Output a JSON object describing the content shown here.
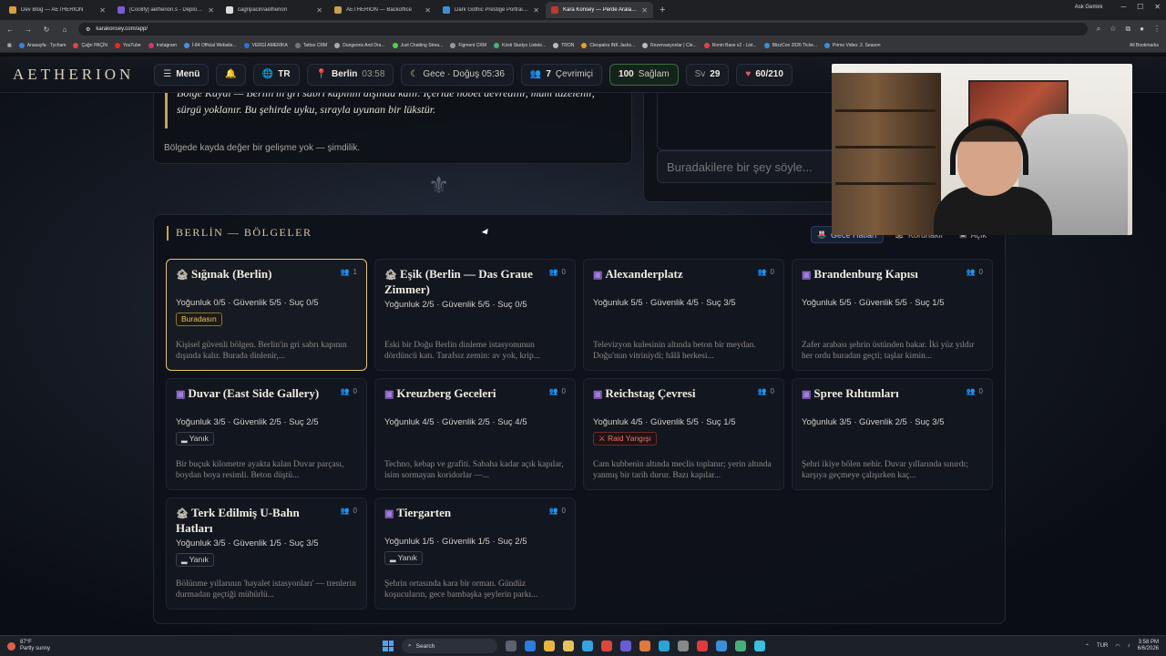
{
  "browser": {
    "tabs": [
      {
        "title": "Dev Blog — AETHERION",
        "color": "#e0a030",
        "active": false
      },
      {
        "title": "[Coolify] aetherion.s - Deploym",
        "color": "#7b5cd6",
        "active": false
      },
      {
        "title": "cagripacin/aetherion",
        "color": "#dddddd",
        "active": false
      },
      {
        "title": "AETHERION — Backoffice",
        "color": "#c9a24a",
        "active": false
      },
      {
        "title": "Dark Gothic Prestige Portraits n",
        "color": "#3a8fd6",
        "active": false
      },
      {
        "title": "Kara Konsey — Perde Aralanıyor",
        "color": "#c0392b",
        "active": true
      }
    ],
    "profile": "Ask Gemini",
    "url": "karakonsey.com/app/",
    "bookmarks": [
      {
        "label": "Anasayfa - Tycham",
        "color": "#3f7fe0"
      },
      {
        "label": "Çağrı PAÇİN",
        "color": "#e04545"
      },
      {
        "label": "YouTube",
        "color": "#ff2020"
      },
      {
        "label": "Instagram",
        "color": "#d6327a"
      },
      {
        "label": "İ-84 Official Website...",
        "color": "#4a90e2"
      },
      {
        "label": "VERGİ AMERİKA",
        "color": "#2d6fd1"
      },
      {
        "label": "Tattoo CRM",
        "color": "#777777"
      },
      {
        "label": "Dungeons And Dra...",
        "color": "#aaaaaa"
      },
      {
        "label": "Just Chatting Strea...",
        "color": "#4fd64f"
      },
      {
        "label": "Figment CRM",
        "color": "#999999"
      },
      {
        "label": "Kristi Studyo Listele...",
        "color": "#46b07a"
      },
      {
        "label": "TRON",
        "color": "#bbbbbb"
      },
      {
        "label": "Cleopatra INK Jacks...",
        "color": "#e0a030"
      },
      {
        "label": "Rezervasyonlar | Cle...",
        "color": "#bbbbbb"
      },
      {
        "label": "Ronin Base v2 - List...",
        "color": "#e04545"
      },
      {
        "label": "BlizzCon 2026 Ticke...",
        "color": "#3a8fd6"
      },
      {
        "label": "Prime Video: 2. Season",
        "color": "#3a8fd6"
      }
    ],
    "all_bookmarks": "All Bookmarks"
  },
  "header": {
    "logo": "AETHERION",
    "menu": "Menü",
    "lang": "TR",
    "city": "Berlin",
    "city_time": "03:58",
    "time_phase": "Gece · Doğuş 05:36",
    "online_count": "7",
    "online_label": "Çevrimiçi",
    "health_value": "100",
    "health_label": "Sağlam",
    "level_label": "Sv",
    "level_value": "29",
    "hp": "60/210"
  },
  "log": {
    "quote": "Bölge Kaydı — Berlin'in gri sabrı kapının dışında kalır. İçeride nöbet devredilir, mum tazelenir, sürgü yoklanır. Bu şehirde uyku, sırayla uyunan bir lükstür.",
    "no_change": "Bölgede kayda değer bir gelişme yok — şimdilik."
  },
  "chat": {
    "placeholder": "Buradakilere bir şey söyle..."
  },
  "regions": {
    "title": "BERLİN — BÖLGELER",
    "legend": [
      {
        "label": "Gece Hatları",
        "active": true
      },
      {
        "label": "Korunaklı",
        "active": false
      },
      {
        "label": "Açık",
        "active": false
      }
    ],
    "cards": [
      {
        "name": "Sığınak (Berlin)",
        "kind": "safe",
        "icon": "🏚",
        "occupants": "1",
        "stats": "Yoğunluk 0/5 · Güvenlik 5/5 · Suç 0/5",
        "tag": "Buradasın",
        "tag_type": "here",
        "desc": "Kişisel güvenli bölgen. Berlin'in gri sabrı kapının dışında kalır. Burada dinlenir,...",
        "current": true
      },
      {
        "name": "Eşik (Berlin — Das Graue Zimmer)",
        "kind": "safe",
        "icon": "🏚",
        "occupants": "0",
        "stats": "Yoğunluk 2/5 · Güvenlik 5/5 · Suç 0/5",
        "tag": "",
        "tag_type": "",
        "desc": "Eski bir Doğu Berlin dinleme istasyonunun dördüncü katı. Tarafsız zemin: av yok, krip...",
        "current": false
      },
      {
        "name": "Alexanderplatz",
        "kind": "wild",
        "icon": "▣",
        "occupants": "0",
        "stats": "Yoğunluk 5/5 · Güvenlik 4/5 · Suç 3/5",
        "tag": "",
        "tag_type": "",
        "desc": "Televizyon kulesinin altında beton bir meydan. Doğu'nun vitriniydi; hâlâ herkesi...",
        "current": false
      },
      {
        "name": "Brandenburg Kapısı",
        "kind": "wild",
        "icon": "▣",
        "occupants": "0",
        "stats": "Yoğunluk 5/5 · Güvenlik 5/5 · Suç 1/5",
        "tag": "",
        "tag_type": "",
        "desc": "Zafer arabası şehrin üstünden bakar. İki yüz yıldır her ordu buradan geçti; taşlar kimin...",
        "current": false
      },
      {
        "name": "Duvar (East Side Gallery)",
        "kind": "wild",
        "icon": "▣",
        "occupants": "0",
        "stats": "Yoğunluk 3/5 · Güvenlik 2/5 · Suç 2/5",
        "tag": "Yanık",
        "tag_type": "burnt",
        "desc": "Bir buçuk kilometre ayakta kalan Duvar parçası, boydan boya resimli. Beton düştü...",
        "current": false
      },
      {
        "name": "Kreuzberg Geceleri",
        "kind": "wild",
        "icon": "▣",
        "occupants": "0",
        "stats": "Yoğunluk 4/5 · Güvenlik 2/5 · Suç 4/5",
        "tag": "",
        "tag_type": "",
        "desc": "Techno, kebap ve grafiti. Sabaha kadar açık kapılar, isim sormayan koridorlar —...",
        "current": false
      },
      {
        "name": "Reichstag Çevresi",
        "kind": "wild",
        "icon": "▣",
        "occupants": "0",
        "stats": "Yoğunluk 4/5 · Güvenlik 5/5 · Suç 1/5",
        "tag": "Raid Yangışı",
        "tag_type": "raid",
        "desc": "Cam kubbenin altında meclis toplanır; yerin altında yanmış bir tarih durur. Bazı kapılar...",
        "current": false
      },
      {
        "name": "Spree Rıhtımları",
        "kind": "wild",
        "icon": "▣",
        "occupants": "0",
        "stats": "Yoğunluk 3/5 · Güvenlik 2/5 · Suç 3/5",
        "tag": "",
        "tag_type": "",
        "desc": "Şehri ikiye bölen nehir. Duvar yıllarında sınırdı; karşıya geçmeye çalışırken kaç...",
        "current": false
      },
      {
        "name": "Terk Edilmiş U-Bahn Hatları",
        "kind": "safe",
        "icon": "🏚",
        "occupants": "0",
        "stats": "Yoğunluk 3/5 · Güvenlik 1/5 · Suç 3/5",
        "tag": "Yanık",
        "tag_type": "burnt",
        "desc": "Bölünme yıllarının 'hayalet istasyonları' — trenlerin durmadan geçtiği mühürlü...",
        "current": false
      },
      {
        "name": "Tiergarten",
        "kind": "wild",
        "icon": "▣",
        "occupants": "0",
        "stats": "Yoğunluk 1/5 · Güvenlik 1/5 · Suç 2/5",
        "tag": "Yanık",
        "tag_type": "burnt",
        "desc": "Şehrin ortasında kara bir orman. Gündüz koşucuların, gece bambaşka şeylerin parkı...",
        "current": false
      }
    ]
  },
  "taskbar": {
    "weather_temp": "87°F",
    "weather_desc": "Partly sunny",
    "search": "Search",
    "lang": "TUR",
    "time": "3:58 PM",
    "date": "6/6/2026"
  }
}
